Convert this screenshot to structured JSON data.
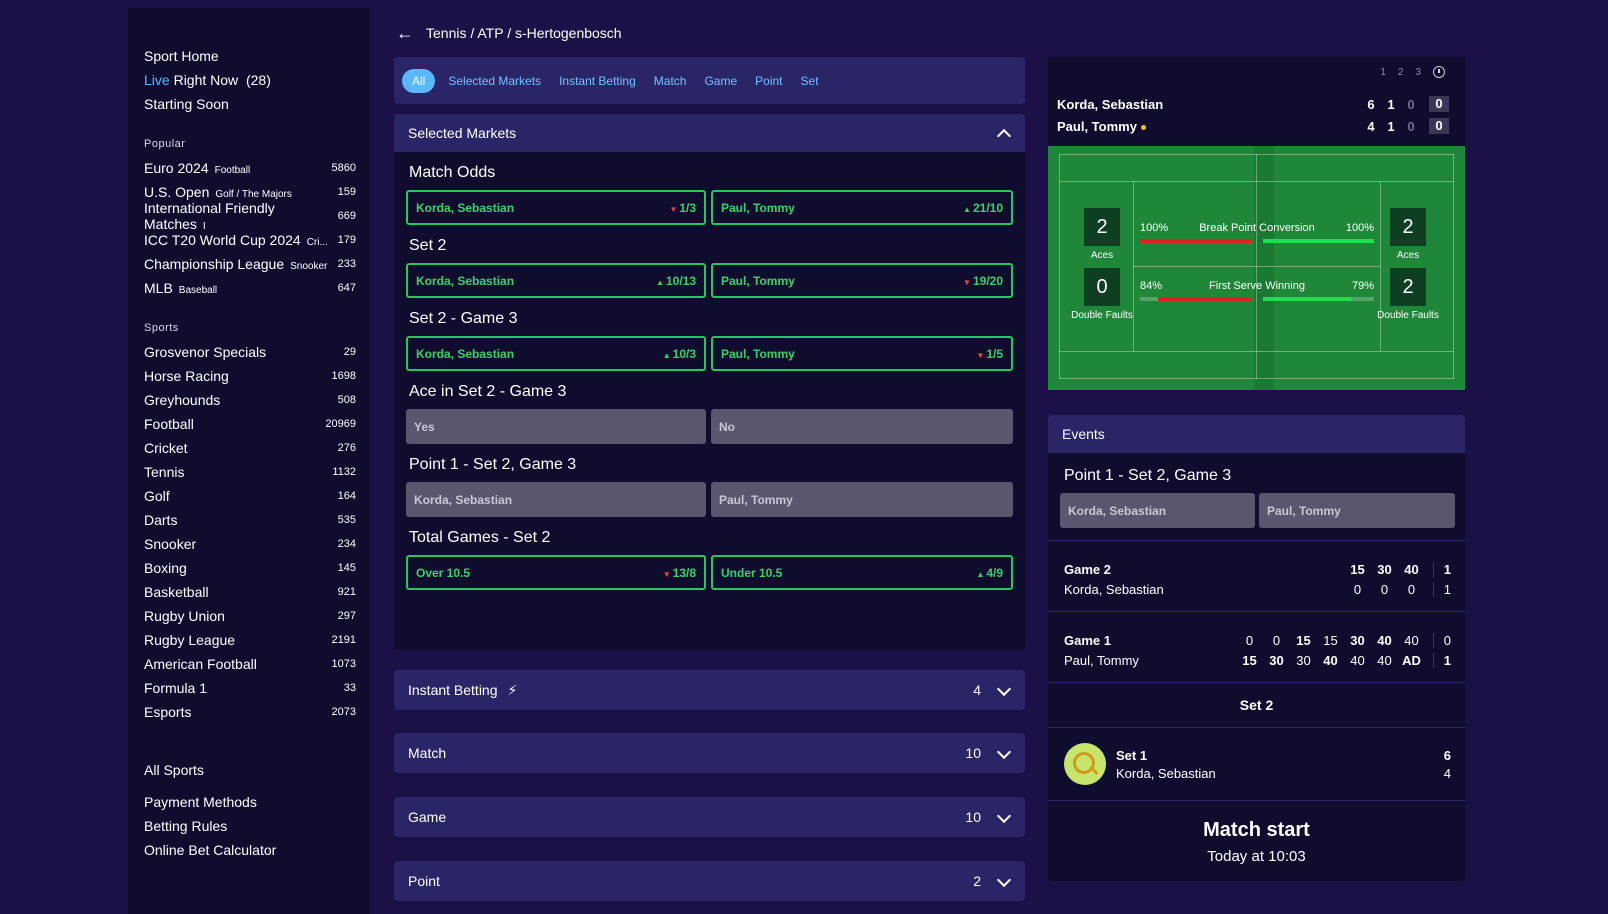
{
  "sidebar": {
    "top": {
      "sport_home": "Sport Home",
      "live": "Live",
      "right_now": "Right Now",
      "live_count": "(28)",
      "starting_soon": "Starting Soon"
    },
    "popular_heading": "Popular",
    "popular": [
      {
        "name": "Euro 2024",
        "sub": "Football",
        "count": "5860"
      },
      {
        "name": "U.S. Open",
        "sub": "Golf / The Majors",
        "count": "159"
      },
      {
        "name": "International Friendly Matches",
        "sub": "I",
        "count": "669"
      },
      {
        "name": "ICC T20 World Cup 2024",
        "sub": "Cri...",
        "count": "179"
      },
      {
        "name": "Championship League",
        "sub": "Snooker",
        "count": "233"
      },
      {
        "name": "MLB",
        "sub": "Baseball",
        "count": "647"
      }
    ],
    "sports_heading": "Sports",
    "sports": [
      {
        "name": "Grosvenor Specials",
        "count": "29"
      },
      {
        "name": "Horse Racing",
        "count": "1698"
      },
      {
        "name": "Greyhounds",
        "count": "508"
      },
      {
        "name": "Football",
        "count": "20969"
      },
      {
        "name": "Cricket",
        "count": "276"
      },
      {
        "name": "Tennis",
        "count": "1132"
      },
      {
        "name": "Golf",
        "count": "164"
      },
      {
        "name": "Darts",
        "count": "535"
      },
      {
        "name": "Snooker",
        "count": "234"
      },
      {
        "name": "Boxing",
        "count": "145"
      },
      {
        "name": "Basketball",
        "count": "921"
      },
      {
        "name": "Rugby Union",
        "count": "297"
      },
      {
        "name": "Rugby League",
        "count": "2191"
      },
      {
        "name": "American Football",
        "count": "1073"
      },
      {
        "name": "Formula 1",
        "count": "33"
      },
      {
        "name": "Esports",
        "count": "2073"
      }
    ],
    "all_sports": "All Sports",
    "payment_methods": "Payment Methods",
    "betting_rules": "Betting Rules",
    "bet_calculator": "Online Bet Calculator"
  },
  "breadcrumb": "Tennis / ATP / s-Hertogenbosch",
  "filters": [
    "All",
    "Selected Markets",
    "Instant Betting",
    "Match",
    "Game",
    "Point",
    "Set"
  ],
  "selected_markets": {
    "heading": "Selected Markets",
    "markets": [
      {
        "title": "Match Odds",
        "a": "Korda, Sebastian",
        "a_odds": "1/3",
        "a_dir": "down",
        "b": "Paul, Tommy",
        "b_odds": "21/10",
        "b_dir": "up"
      },
      {
        "title": "Set 2",
        "a": "Korda, Sebastian",
        "a_odds": "10/13",
        "a_dir": "up",
        "b": "Paul, Tommy",
        "b_odds": "19/20",
        "b_dir": "down"
      },
      {
        "title": "Set 2 - Game 3",
        "a": "Korda, Sebastian",
        "a_odds": "10/3",
        "a_dir": "up",
        "b": "Paul, Tommy",
        "b_odds": "1/5",
        "b_dir": "down"
      },
      {
        "title": "Ace in Set 2 - Game 3",
        "a": "Yes",
        "b": "No",
        "suspended": true
      },
      {
        "title": "Point 1 - Set 2, Game 3",
        "a": "Korda, Sebastian",
        "b": "Paul, Tommy",
        "suspended": true
      },
      {
        "title": "Total Games - Set 2",
        "a": "Over  10.5",
        "a_odds": "13/8",
        "a_dir": "down",
        "b": "Under  10.5",
        "b_odds": "4/9",
        "b_dir": "up"
      }
    ]
  },
  "groups": [
    {
      "label": "Instant Betting",
      "count": "4",
      "bolt": true
    },
    {
      "label": "Match",
      "count": "10"
    },
    {
      "label": "Game",
      "count": "10"
    },
    {
      "label": "Point",
      "count": "2"
    }
  ],
  "scoreboard": {
    "set_heads": [
      "1",
      "2",
      "3"
    ],
    "players": [
      {
        "name": "Korda, Sebastian",
        "sets": [
          "6",
          "1",
          "0"
        ],
        "points": "0",
        "serving": false
      },
      {
        "name": "Paul, Tommy",
        "sets": [
          "4",
          "1",
          "0"
        ],
        "points": "0",
        "serving": true
      }
    ]
  },
  "stats": {
    "p1_aces": "2",
    "p2_aces": "2",
    "aces_label": "Aces",
    "p1_df": "0",
    "p2_df": "2",
    "df_label": "Double Faults",
    "bp_label": "Break Point Conversion",
    "bp_p1": "100%",
    "bp_p2": "100%",
    "bp_p1_val": 100,
    "bp_p2_val": 100,
    "fs_label": "First Serve Winning",
    "fs_p1": "84%",
    "fs_p2": "79%",
    "fs_p1_val": 84,
    "fs_p2_val": 79,
    "colors": {
      "p1": "#e02020",
      "p2": "#1fe04a"
    }
  },
  "events": {
    "heading": "Events",
    "point_title": "Point 1 - Set 2, Game 3",
    "point_a": "Korda, Sebastian",
    "point_b": "Paul, Tommy",
    "game2": {
      "label": "Game 2",
      "server": "Korda, Sebastian",
      "top": [
        "15",
        "30",
        "40"
      ],
      "bottom": [
        "0",
        "0",
        "0"
      ],
      "top_total": "1",
      "bottom_total": "1"
    },
    "game1": {
      "label": "Game 1",
      "server": "Paul, Tommy",
      "top": [
        "0",
        "0",
        "15",
        "15",
        "30",
        "40",
        "40"
      ],
      "bottom": [
        "15",
        "30",
        "30",
        "40",
        "40",
        "40",
        "AD"
      ],
      "top_total": "0",
      "bottom_total": "1"
    },
    "set2_label": "Set 2",
    "set1": {
      "label": "Set 1",
      "name": "Korda, Sebastian",
      "score_a": "6",
      "score_b": "4"
    },
    "match_start": "Match start",
    "match_time": "Today at 10:03"
  }
}
